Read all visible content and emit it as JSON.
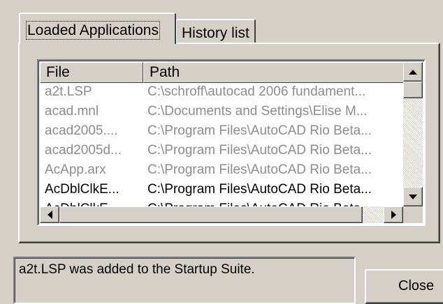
{
  "tabs": [
    {
      "label": "Loaded Applications",
      "active": true
    },
    {
      "label": "History list",
      "active": false
    }
  ],
  "list": {
    "columns": [
      "File",
      "Path"
    ],
    "rows": [
      {
        "file": "a2t.LSP",
        "path": "C:\\schroff\\autocad 2006 fundament...",
        "dimmed": true
      },
      {
        "file": "acad.mnl",
        "path": "C:\\Documents and Settings\\Elise M...",
        "dimmed": true
      },
      {
        "file": "acad2005....",
        "path": "C:\\Program Files\\AutoCAD Rio Beta...",
        "dimmed": true
      },
      {
        "file": "acad2005d...",
        "path": "C:\\Program Files\\AutoCAD Rio Beta...",
        "dimmed": true
      },
      {
        "file": "AcApp.arx",
        "path": "C:\\Program Files\\AutoCAD Rio Beta...",
        "dimmed": true
      },
      {
        "file": "AcDblClkE...",
        "path": "C:\\Program Files\\AutoCAD Rio Beta...",
        "dimmed": false
      },
      {
        "file": "AcDblClkE...",
        "path": "C:\\Program Files\\AutoCAD Rio Beta...",
        "dimmed": false
      }
    ]
  },
  "scrollbars": {
    "vertical_position": 0.0,
    "horizontal_position": 0.0
  },
  "status": {
    "text": "a2t.LSP was added to the Startup Suite."
  },
  "buttons": {
    "close_label": "Close"
  },
  "colors": {
    "face": "#d4d0c8",
    "dimmed_text": "#8c8c8c",
    "text": "#000000",
    "list_background": "#ffffff"
  },
  "icons": {
    "scroll_up": "arrow-up-icon",
    "scroll_down": "arrow-down-icon",
    "scroll_left": "arrow-left-icon",
    "scroll_right": "arrow-right-icon"
  }
}
